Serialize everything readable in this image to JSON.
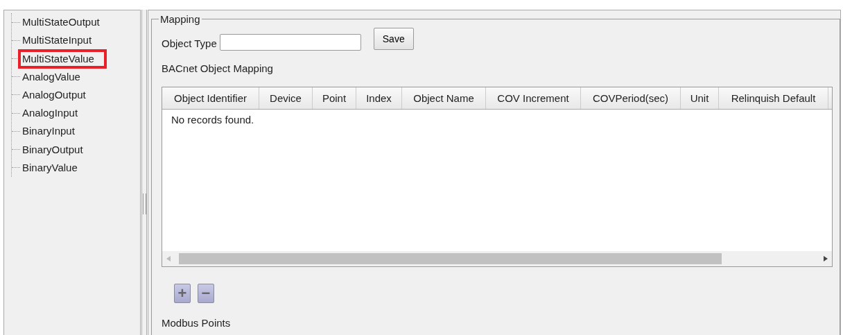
{
  "tree": {
    "items": [
      {
        "label": "MultiStateOutput",
        "selected": false
      },
      {
        "label": "MultiStateInput",
        "selected": false
      },
      {
        "label": "MultiStateValue",
        "selected": true
      },
      {
        "label": "AnalogValue",
        "selected": false
      },
      {
        "label": "AnalogOutput",
        "selected": false
      },
      {
        "label": "AnalogInput",
        "selected": false
      },
      {
        "label": "BinaryInput",
        "selected": false
      },
      {
        "label": "BinaryOutput",
        "selected": false
      },
      {
        "label": "BinaryValue",
        "selected": false
      }
    ]
  },
  "mapping": {
    "legend": "Mapping",
    "object_type_label": "Object Type",
    "save_button": "Save",
    "table_title": "BACnet Object Mapping",
    "table": {
      "columns": [
        "Object Identifier",
        "Device",
        "Point",
        "Index",
        "Object Name",
        "COV Increment",
        "COVPeriod(sec)",
        "Unit",
        "Relinquish Default"
      ],
      "empty_message": "No records found."
    },
    "add_button": "+",
    "remove_button": "−",
    "modbus_title": "Modbus Points"
  }
}
